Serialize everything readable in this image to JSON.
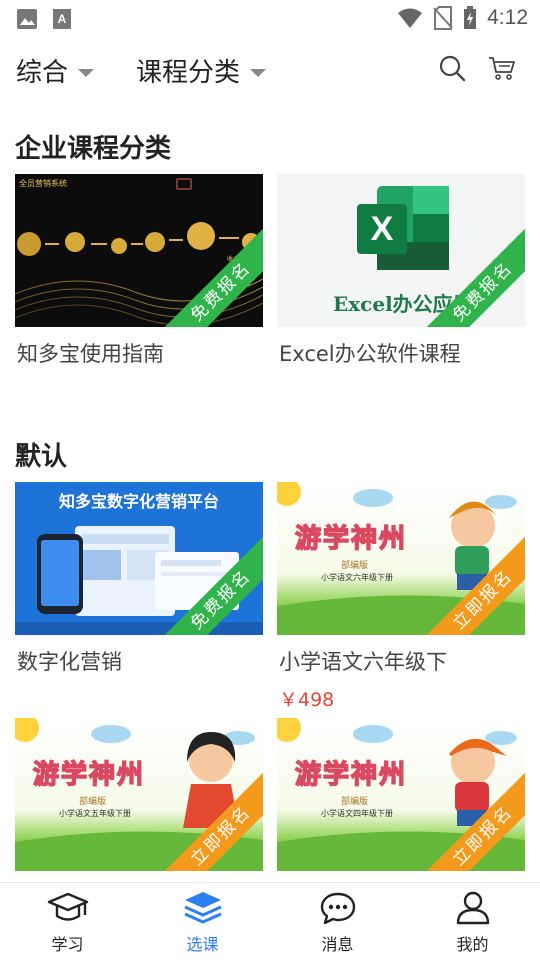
{
  "status_bar": {
    "time": "4:12"
  },
  "filters": {
    "sort_label": "综合",
    "category_label": "课程分类"
  },
  "sections": [
    {
      "title": "企业课程分类",
      "cards": [
        {
          "title": "知多宝使用指南",
          "badge": "免费报名",
          "thumb_heading": "全员营销系统",
          "thumb_sub": "收入全景"
        },
        {
          "title": "Excel办公软件课程",
          "badge": "免费报名",
          "thumb_heading": "Excel办公应用"
        }
      ]
    },
    {
      "title": "默认",
      "cards": [
        {
          "title": "数字化营销",
          "badge": "免费报名",
          "thumb_heading": "知多宝数字化营销平台"
        },
        {
          "title": "小学语文六年级下",
          "price": "￥498",
          "badge": "立即报名",
          "thumb_heading": "游学神州",
          "thumb_edition": "部编版",
          "thumb_sub": "小学语文六年级下册"
        },
        {
          "badge": "立即报名",
          "thumb_heading": "游学神州",
          "thumb_edition": "部编版",
          "thumb_sub": "小学语文五年级下册"
        },
        {
          "badge": "立即报名",
          "thumb_heading": "游学神州",
          "thumb_edition": "部编版",
          "thumb_sub": "小学语文四年级下册"
        }
      ]
    }
  ],
  "bottom_nav": [
    {
      "label": "学习",
      "icon": "graduation-cap-icon"
    },
    {
      "label": "选课",
      "icon": "layers-icon",
      "active": true
    },
    {
      "label": "消息",
      "icon": "chat-bubble-icon"
    },
    {
      "label": "我的",
      "icon": "person-icon"
    }
  ],
  "colors": {
    "accent": "#2c7ff0",
    "price": "#e54535",
    "ribbon_free": "#2fb34a",
    "ribbon_enroll": "#f39a1c"
  }
}
